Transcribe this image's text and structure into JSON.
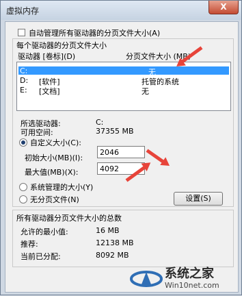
{
  "window": {
    "title": "虚拟内存",
    "close_label": "X"
  },
  "auto_manage": {
    "label": "自动管理所有驱动器的分页文件大小(A)",
    "checked": false
  },
  "per_drive_group": {
    "title": "每个驱动器的分页文件大小",
    "col_drive": "驱动器 [卷标](D)",
    "col_size": "分页文件大小 (MB)",
    "rows": [
      {
        "drive": "C:",
        "label": "",
        "size": "无",
        "selected": true
      },
      {
        "drive": "D:",
        "label": "[软件]",
        "size": "托管的系统",
        "selected": false
      },
      {
        "drive": "E:",
        "label": "[文档]",
        "size": "无",
        "selected": false
      }
    ]
  },
  "selected_drive": {
    "label": "所选驱动器:",
    "value": "C:"
  },
  "free_space": {
    "label": "可用空间:",
    "value": "37355 MB"
  },
  "custom_size": {
    "label": "自定义大小(C):",
    "checked": true
  },
  "initial_size": {
    "label": "初始大小(MB)(I):",
    "value": "2046"
  },
  "max_size": {
    "label": "最大值(MB)(X):",
    "value": "4092"
  },
  "system_managed": {
    "label": "系统管理的大小(Y)",
    "checked": false
  },
  "no_paging": {
    "label": "无分页文件(N)",
    "checked": false
  },
  "set_button": {
    "label": "设置(S)"
  },
  "total_group": {
    "title": "所有驱动器分页文件大小的总数",
    "min_label": "允许的最小值:",
    "min_value": "16 MB",
    "recommended_label": "推荐:",
    "recommended_value": "12138 MB",
    "current_label": "当前已分配:",
    "current_value": "8092 MB"
  },
  "watermark": {
    "line1": "系统之家",
    "line2": "Win10net.com"
  },
  "colors": {
    "selection": "#3399ff",
    "annotation_arrow": "#e7443a"
  }
}
